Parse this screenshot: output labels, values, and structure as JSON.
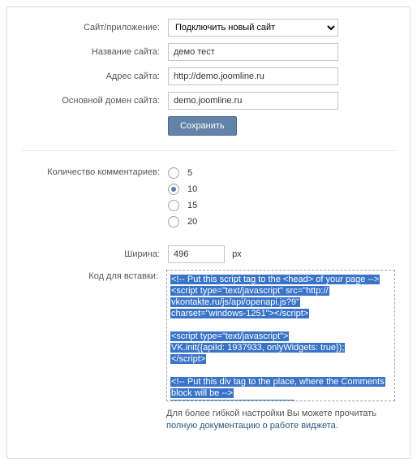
{
  "form": {
    "site_app_label": "Сайт/приложение:",
    "site_app_value": "Подключить новый сайт",
    "site_name_label": "Название сайта:",
    "site_name_value": "демо тест",
    "site_addr_label": "Адрес сайта:",
    "site_addr_value": "http://demo.joomline.ru",
    "main_domain_label": "Основной домен сайта:",
    "main_domain_value": "demo.joomline.ru",
    "save_label": "Сохранить"
  },
  "count": {
    "label": "Количество комментариев:",
    "options": [
      "5",
      "10",
      "15",
      "20"
    ],
    "selected_index": 1
  },
  "width": {
    "label": "Ширина:",
    "value": "496",
    "unit": "px"
  },
  "code": {
    "label": "Код для вставки:",
    "lines": [
      "<!-- Put this script tag to the <head> of your page -->",
      "<script type=\"text/javascript\" src=\"http://",
      "vkontakte.ru/js/api/openapi.js?9\"",
      "charset=\"windows-1251\"></scr​ipt>",
      "",
      "<script type=\"text/javascript\">",
      " VK.init({apiId: 1937933, onlyWidgets: true});",
      "</scr​ipt>",
      "",
      "<!-- Put this div tag to the place, where the Comments",
      "block will be -->",
      "<div id=\"vk_comments\"></div>"
    ]
  },
  "footnote": {
    "text_before": "Для более гибкой настройки Вы можете прочитать ",
    "link_text": "полную документацию о работе виджета",
    "text_after": "."
  }
}
